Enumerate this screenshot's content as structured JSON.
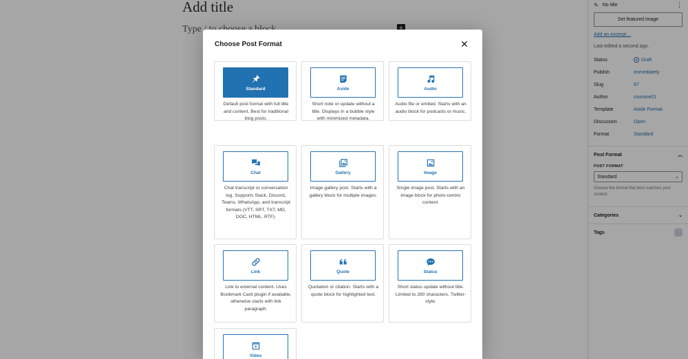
{
  "editor": {
    "title_placeholder": "Add title",
    "body_placeholder": "Type / to choose a block",
    "inserter_glyph": "+"
  },
  "sidebar": {
    "post_title": "No title",
    "featured_button": "Set featured image",
    "excerpt_link": "Add an excerpt…",
    "last_edited": "Last edited a second ago.",
    "meta": [
      {
        "key": "Status",
        "value": "Draft"
      },
      {
        "key": "Publish",
        "value": "Immediately"
      },
      {
        "key": "Slug",
        "value": "87"
      },
      {
        "key": "Author",
        "value": "courane01"
      },
      {
        "key": "Template",
        "value": "Aside Format"
      },
      {
        "key": "Discussion",
        "value": "Open"
      },
      {
        "key": "Format",
        "value": "Standard"
      }
    ],
    "post_format_panel": {
      "title": "Post Format",
      "label": "POST FORMAT",
      "selected": "Standard",
      "help": "Choose the format that best matches your content."
    },
    "categories_label": "Categories",
    "tags_label": "Tags"
  },
  "modal": {
    "title": "Choose Post Format",
    "close_glyph": "✕",
    "formats": [
      {
        "label": "Standard",
        "icon": "pin-icon",
        "selected": true,
        "desc": "Default post format with full title and content. Best for traditional blog posts."
      },
      {
        "label": "Aside",
        "icon": "aside-icon",
        "selected": false,
        "desc": "Short note or update without a title. Displays in a bubble style with minimized metadata."
      },
      {
        "label": "Audio",
        "icon": "music-note-icon",
        "selected": false,
        "desc": "Audio file or embed. Starts with an audio block for podcasts or music."
      },
      {
        "label": "Chat",
        "icon": "chat-bubbles-icon",
        "selected": false,
        "desc": "Chat transcript or conversation log. Supports Slack, Discord, Teams, WhatsApp, and transcript formats (VTT, SRT, TXT, MD, DOC, HTML, RTF)."
      },
      {
        "label": "Gallery",
        "icon": "gallery-icon",
        "selected": false,
        "desc": "Image gallery post. Starts with a gallery block for multiple images."
      },
      {
        "label": "Image",
        "icon": "image-icon",
        "selected": false,
        "desc": "Single image post. Starts with an image block for photo-centric content."
      },
      {
        "label": "Link",
        "icon": "link-icon",
        "selected": false,
        "desc": "Link to external content. Uses Bookmark Card plugin if available, otherwise starts with link paragraph."
      },
      {
        "label": "Quote",
        "icon": "quote-icon",
        "selected": false,
        "desc": "Quotation or citation. Starts with a quote block for highlighted text."
      },
      {
        "label": "Status",
        "icon": "status-bubble-icon",
        "selected": false,
        "desc": "Short status update without title. Limited to 280 characters, Twitter-style."
      },
      {
        "label": "Video",
        "icon": "video-icon",
        "selected": false,
        "desc": ""
      }
    ]
  },
  "colors": {
    "accent": "#2271b1",
    "overlay": "rgba(0,0,0,0.35)"
  }
}
